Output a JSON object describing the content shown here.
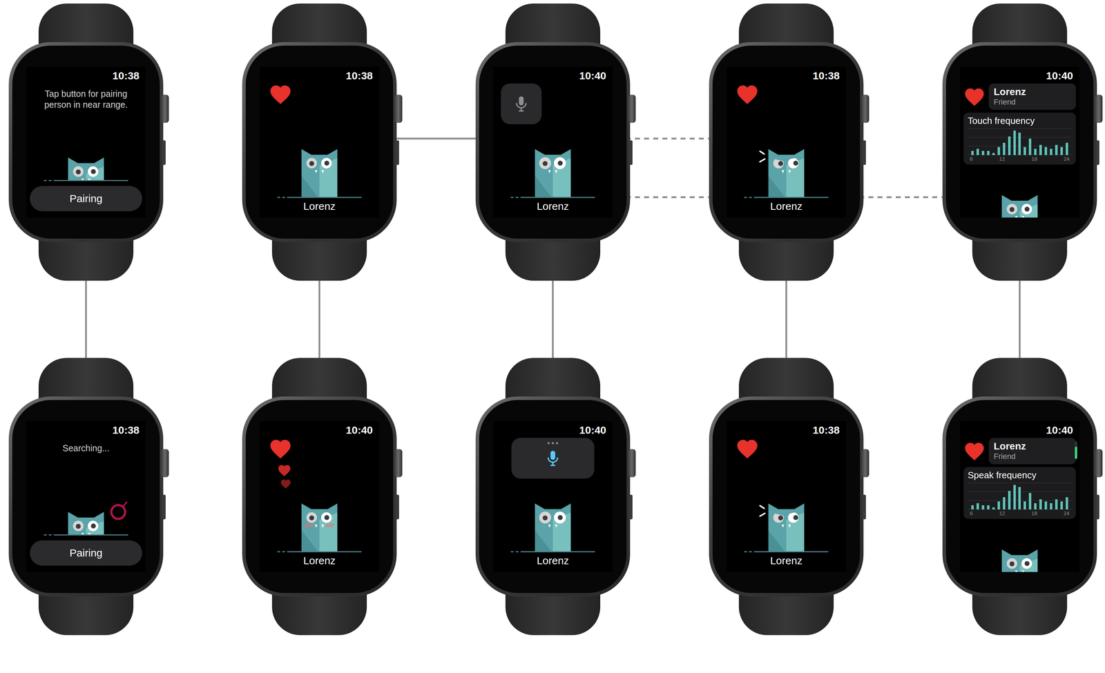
{
  "diagram": {
    "screens": [
      {
        "kind": "pairing",
        "time": "10:38",
        "message": "Tap button for pairing person in near range.",
        "button": "Pairing",
        "searching": false
      },
      {
        "kind": "owl",
        "time": "10:38",
        "heart": true,
        "expression": "neutral",
        "name": "Lorenz"
      },
      {
        "kind": "mic",
        "time": "10:40",
        "recording": false,
        "expression": "listening",
        "name": "Lorenz"
      },
      {
        "kind": "owl",
        "time": "10:38",
        "heart": true,
        "expression": "side-eye",
        "name": "Lorenz"
      },
      {
        "kind": "stats",
        "time": "10:40",
        "heart": true,
        "name": "Lorenz",
        "relation": "Friend",
        "chart": {
          "title": "Touch frequency",
          "ticks": [
            "6",
            "12",
            "18",
            "24"
          ],
          "values": [
            2,
            3,
            2,
            2,
            1,
            4,
            6,
            9,
            12,
            11,
            4,
            8,
            3,
            5,
            4,
            3,
            5,
            4,
            6
          ]
        },
        "scroll_level": 0
      },
      {
        "kind": "pairing",
        "time": "10:38",
        "message": "Searching...",
        "button": "Pairing",
        "searching": true
      },
      {
        "kind": "owl",
        "time": "10:40",
        "heart": true,
        "expression": "blush",
        "name": "Lorenz"
      },
      {
        "kind": "mic",
        "time": "10:40",
        "recording": true,
        "expression": "listening",
        "name": "Lorenz"
      },
      {
        "kind": "owl",
        "time": "10:38",
        "heart": true,
        "expression": "side-eye",
        "name": "Lorenz"
      },
      {
        "kind": "stats",
        "time": "10:40",
        "heart": true,
        "name": "Lorenz",
        "relation": "Friend",
        "chart": {
          "title": "Speak frequency",
          "ticks": [
            "6",
            "12",
            "18",
            "24"
          ],
          "values": [
            2,
            3,
            2,
            2,
            1,
            4,
            6,
            9,
            12,
            11,
            4,
            8,
            3,
            5,
            4,
            3,
            5,
            4,
            6
          ]
        },
        "scroll_level": 0.7
      }
    ],
    "connections": [
      {
        "from": 0,
        "to": 5,
        "style": "solid"
      },
      {
        "from": 1,
        "to": 6,
        "style": "solid"
      },
      {
        "from": 2,
        "to": 7,
        "style": "solid"
      },
      {
        "from": 3,
        "to": 8,
        "style": "solid"
      },
      {
        "from": 4,
        "to": 9,
        "style": "solid"
      },
      {
        "from": 1,
        "to": 2,
        "style": "solid",
        "lane": "upper"
      },
      {
        "from": 2,
        "to": 3,
        "style": "dashed",
        "lane": "upper"
      },
      {
        "from": 2,
        "to": 3,
        "style": "dashed",
        "lane": "lower"
      },
      {
        "from": 3,
        "to": 4,
        "style": "dashed",
        "lane": "lower"
      }
    ]
  }
}
